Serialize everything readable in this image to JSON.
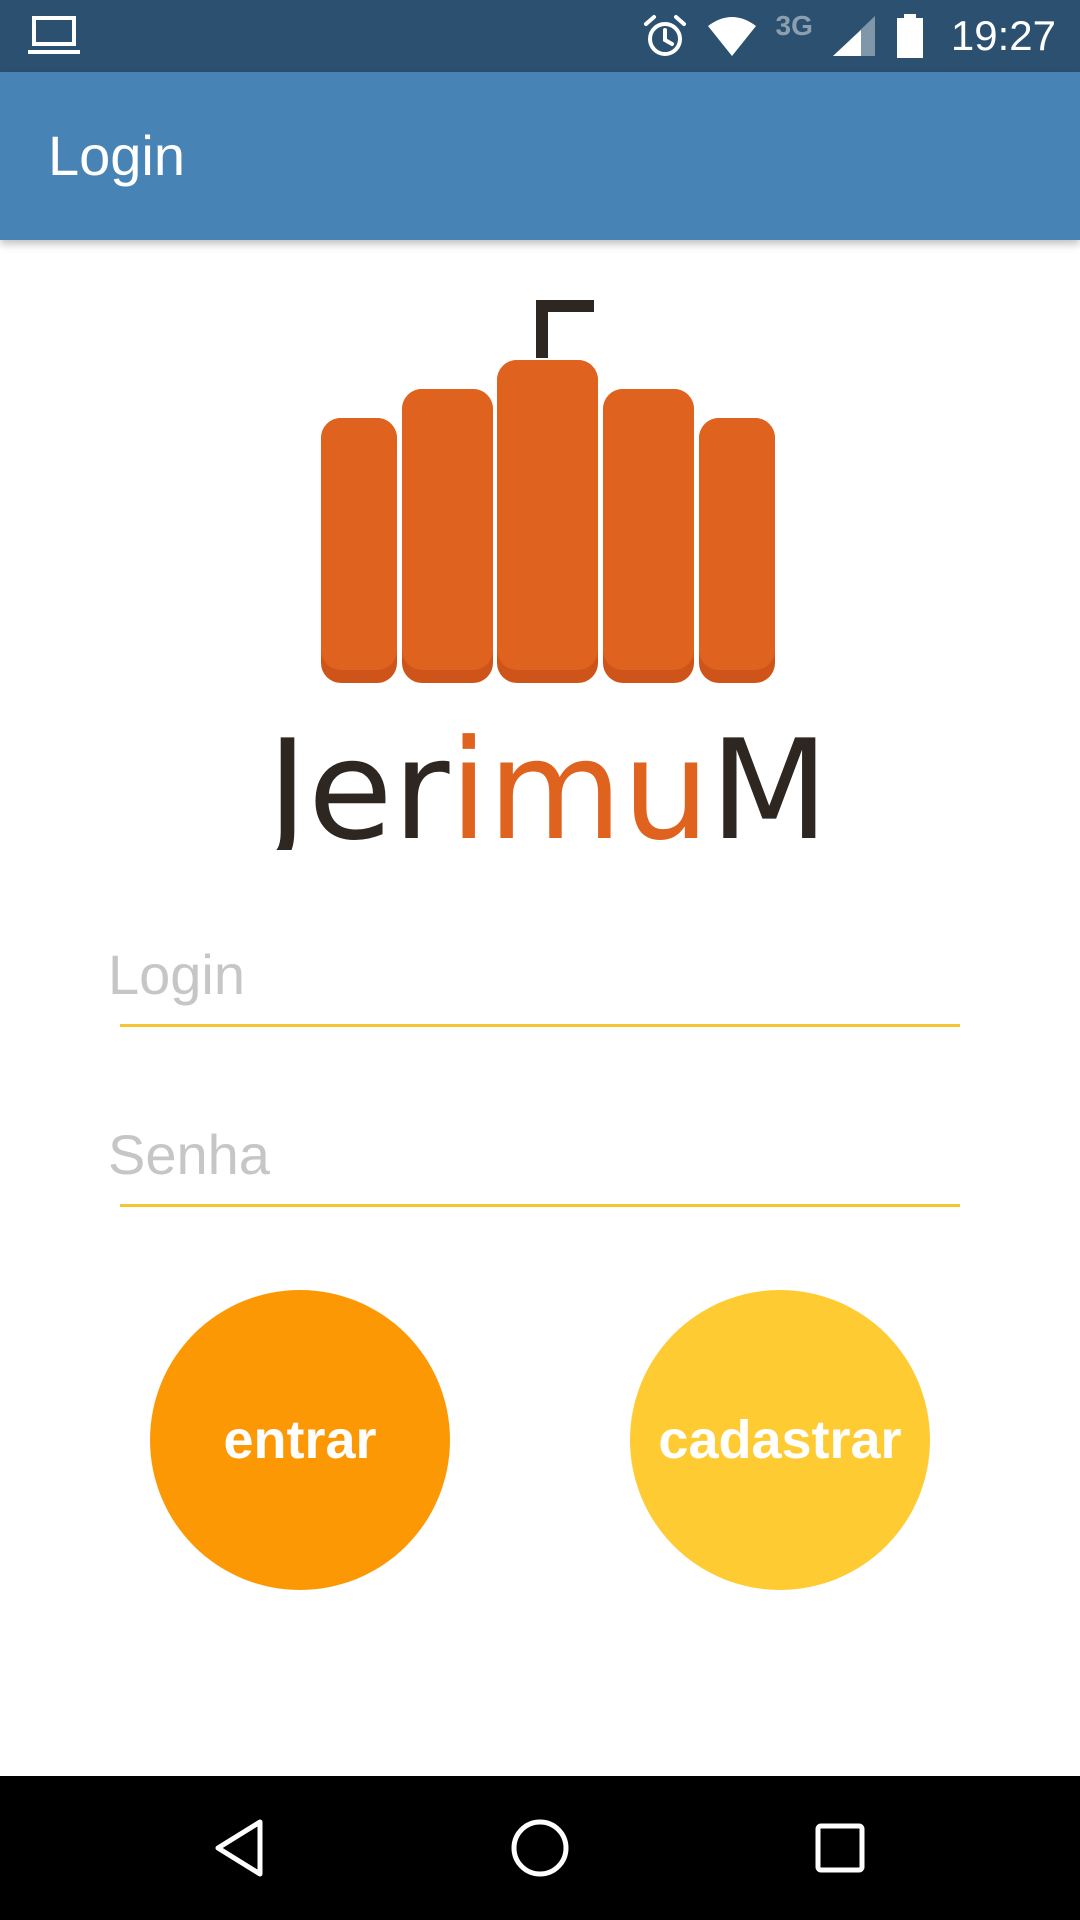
{
  "status_bar": {
    "left_icon": "laptop-icon",
    "icons": [
      "alarm-icon",
      "wifi-icon",
      "cell-signal-icon",
      "battery-icon"
    ],
    "network_type": "3G",
    "time": "19:27"
  },
  "app_bar": {
    "title": "Login"
  },
  "logo": {
    "text": "JerimuM",
    "text_parts": [
      "Jer",
      "imu",
      "M"
    ],
    "colors": {
      "pumpkin": "#e0621f",
      "pumpkin_shade": "#cf5419",
      "stem": "#2e2621",
      "text_dark": "#2e2621",
      "text_accent": "#e0621f"
    }
  },
  "form": {
    "login": {
      "placeholder": "Login",
      "value": ""
    },
    "password": {
      "placeholder": "Senha",
      "value": ""
    },
    "underline_color": "#f7c530"
  },
  "buttons": {
    "enter": {
      "label": "entrar",
      "color": "#fd9805"
    },
    "register": {
      "label": "cadastrar",
      "color": "#fecb33"
    }
  },
  "nav_bar": {
    "icons": [
      "back-icon",
      "home-icon",
      "recents-icon"
    ]
  },
  "colors": {
    "status_bar": "#2c5070",
    "app_bar": "#4883b6"
  }
}
